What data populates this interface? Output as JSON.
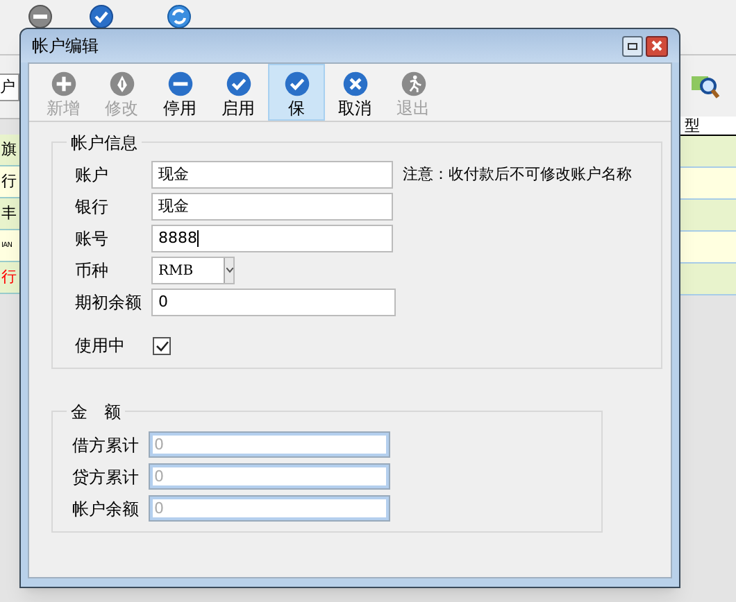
{
  "background": {
    "search_field": {
      "value": "户"
    },
    "left_table": {
      "cells": [
        {
          "text": "旗",
          "color": "#000000"
        },
        {
          "text": "行",
          "color": "#000000"
        },
        {
          "text": "丰",
          "color": "#000000"
        },
        {
          "text": "IAN",
          "color": "#000000"
        },
        {
          "text": "行",
          "color": "#ff0000"
        }
      ]
    },
    "right_table": {
      "header": "型"
    }
  },
  "window": {
    "title": "帐户编辑"
  },
  "toolbar": [
    {
      "label": "新增",
      "kind": "plus",
      "disabled": true,
      "selected": false
    },
    {
      "label": "修改",
      "kind": "pen",
      "disabled": true,
      "selected": false
    },
    {
      "label": "停用",
      "kind": "minus",
      "disabled": false,
      "selected": false
    },
    {
      "label": "启用",
      "kind": "check",
      "disabled": false,
      "selected": false
    },
    {
      "label": "保",
      "kind": "check",
      "disabled": false,
      "selected": true
    },
    {
      "label": "取消",
      "kind": "cross",
      "disabled": false,
      "selected": false
    },
    {
      "label": "退出",
      "kind": "exit",
      "disabled": true,
      "selected": false
    }
  ],
  "account_info": {
    "title": "帐户信息",
    "fields": [
      {
        "kind": "text",
        "label": "账户",
        "value": "现金",
        "note": "注意：收付款后不可修改账户名称"
      },
      {
        "kind": "text",
        "label": "银行",
        "value": "现金"
      },
      {
        "kind": "text",
        "label": "账号",
        "value": "8888",
        "focused": true
      },
      {
        "kind": "select",
        "label": "币种",
        "value": "RMB"
      },
      {
        "kind": "text",
        "label": "期初余额",
        "value": "0"
      },
      {
        "kind": "checkbox",
        "label": "使用中",
        "checked": true
      }
    ]
  },
  "amounts": {
    "title": "金　额",
    "fields": [
      {
        "label": "借方累计",
        "value": "0",
        "disabled": true
      },
      {
        "label": "贷方累计",
        "value": "0",
        "disabled": true
      },
      {
        "label": "帐户余额",
        "value": "0",
        "disabled": true
      }
    ]
  }
}
